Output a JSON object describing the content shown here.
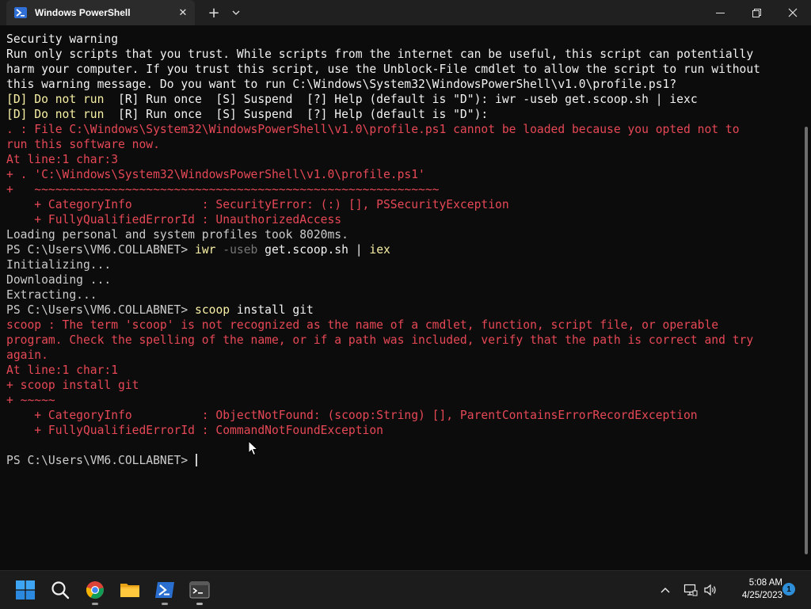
{
  "window": {
    "tab_title": "Windows PowerShell",
    "new_tab_symbol": "+",
    "tab_close_symbol": "✕"
  },
  "terminal": {
    "lines": [
      {
        "segments": [
          {
            "t": "Security warning",
            "c": "white"
          }
        ]
      },
      {
        "segments": [
          {
            "t": "Run only scripts that you trust. While scripts from the internet can be useful, this script can potentially",
            "c": "white"
          }
        ]
      },
      {
        "segments": [
          {
            "t": "harm your computer. If you trust this script, use the Unblock-File cmdlet to allow the script to run without",
            "c": "white"
          }
        ]
      },
      {
        "segments": [
          {
            "t": "this warning message. Do you want to run C:\\Windows\\System32\\WindowsPowerShell\\v1.0\\profile.ps1?",
            "c": "white"
          }
        ]
      },
      {
        "segments": [
          {
            "t": "[D] Do not run  ",
            "c": "yellow"
          },
          {
            "t": "[R] Run once  [S] Suspend  [?] Help (default is \"D\"): iwr -useb get.scoop.sh | iexc",
            "c": "white"
          }
        ]
      },
      {
        "segments": [
          {
            "t": "[D] Do not run  ",
            "c": "yellow"
          },
          {
            "t": "[R] Run once  [S] Suspend  [?] Help (default is \"D\"):",
            "c": "white"
          }
        ]
      },
      {
        "segments": [
          {
            "t": ". : File C:\\Windows\\System32\\WindowsPowerShell\\v1.0\\profile.ps1 cannot be loaded because you opted not to",
            "c": "red"
          }
        ]
      },
      {
        "segments": [
          {
            "t": "run this software now.",
            "c": "red"
          }
        ]
      },
      {
        "segments": [
          {
            "t": "At line:1 char:3",
            "c": "red"
          }
        ]
      },
      {
        "segments": [
          {
            "t": "+ . 'C:\\Windows\\System32\\WindowsPowerShell\\v1.0\\profile.ps1'",
            "c": "red"
          }
        ]
      },
      {
        "segments": [
          {
            "t": "+   ~~~~~~~~~~~~~~~~~~~~~~~~~~~~~~~~~~~~~~~~~~~~~~~~~~~~~~~~~~",
            "c": "red"
          }
        ]
      },
      {
        "segments": [
          {
            "t": "    + CategoryInfo          : SecurityError: (:) [], PSSecurityException",
            "c": "red"
          }
        ]
      },
      {
        "segments": [
          {
            "t": "    + FullyQualifiedErrorId : UnauthorizedAccess",
            "c": "red"
          }
        ]
      },
      {
        "segments": [
          {
            "t": "Loading personal and system profiles took 8020ms.",
            "c": "default"
          }
        ]
      },
      {
        "segments": [
          {
            "t": "PS C:\\Users\\VM6.COLLABNET> ",
            "c": "default"
          },
          {
            "t": "iwr ",
            "c": "yellow"
          },
          {
            "t": "-useb ",
            "c": "gray"
          },
          {
            "t": "get.scoop.sh | ",
            "c": "white"
          },
          {
            "t": "iex",
            "c": "yellow"
          }
        ]
      },
      {
        "segments": [
          {
            "t": "Initializing...",
            "c": "default"
          }
        ]
      },
      {
        "segments": [
          {
            "t": "Downloading ...",
            "c": "default"
          }
        ]
      },
      {
        "segments": [
          {
            "t": "Extracting...",
            "c": "default"
          }
        ]
      },
      {
        "segments": [
          {
            "t": "PS C:\\Users\\VM6.COLLABNET> ",
            "c": "default"
          },
          {
            "t": "scoop ",
            "c": "yellow"
          },
          {
            "t": "install git",
            "c": "white"
          }
        ]
      },
      {
        "segments": [
          {
            "t": "scoop : The term 'scoop' is not recognized as the name of a cmdlet, function, script file, or operable",
            "c": "red"
          }
        ]
      },
      {
        "segments": [
          {
            "t": "program. Check the spelling of the name, or if a path was included, verify that the path is correct and try",
            "c": "red"
          }
        ]
      },
      {
        "segments": [
          {
            "t": "again.",
            "c": "red"
          }
        ]
      },
      {
        "segments": [
          {
            "t": "At line:1 char:1",
            "c": "red"
          }
        ]
      },
      {
        "segments": [
          {
            "t": "+ scoop install git",
            "c": "red"
          }
        ]
      },
      {
        "segments": [
          {
            "t": "+ ~~~~~",
            "c": "red"
          }
        ]
      },
      {
        "segments": [
          {
            "t": "    + CategoryInfo          : ObjectNotFound: (scoop:String) [], ParentContainsErrorRecordException",
            "c": "red"
          }
        ]
      },
      {
        "segments": [
          {
            "t": "    + FullyQualifiedErrorId : CommandNotFoundException",
            "c": "red"
          }
        ]
      },
      {
        "segments": [
          {
            "t": " ",
            "c": "default"
          }
        ]
      },
      {
        "segments": [
          {
            "t": "PS C:\\Users\\VM6.COLLABNET> ",
            "c": "default"
          }
        ],
        "cursor": true
      }
    ]
  },
  "colors": {
    "default": "#cccccc",
    "white": "#f2f2f2",
    "yellow": "#f9f1a5",
    "red": "#e74856",
    "gray": "#767676"
  },
  "taskbar": {
    "apps": [
      {
        "name": "start-button",
        "icon": "windows-logo-icon"
      },
      {
        "name": "search-button",
        "icon": "search-icon"
      },
      {
        "name": "chrome-app",
        "icon": "chrome-icon",
        "running": true
      },
      {
        "name": "file-explorer-app",
        "icon": "folder-icon"
      },
      {
        "name": "powershell-app",
        "icon": "powershell-icon",
        "running": true
      },
      {
        "name": "terminal-app",
        "icon": "terminal-icon",
        "running": true
      }
    ],
    "time": "5:08 AM",
    "date": "4/25/2023",
    "notification_count": "1"
  }
}
